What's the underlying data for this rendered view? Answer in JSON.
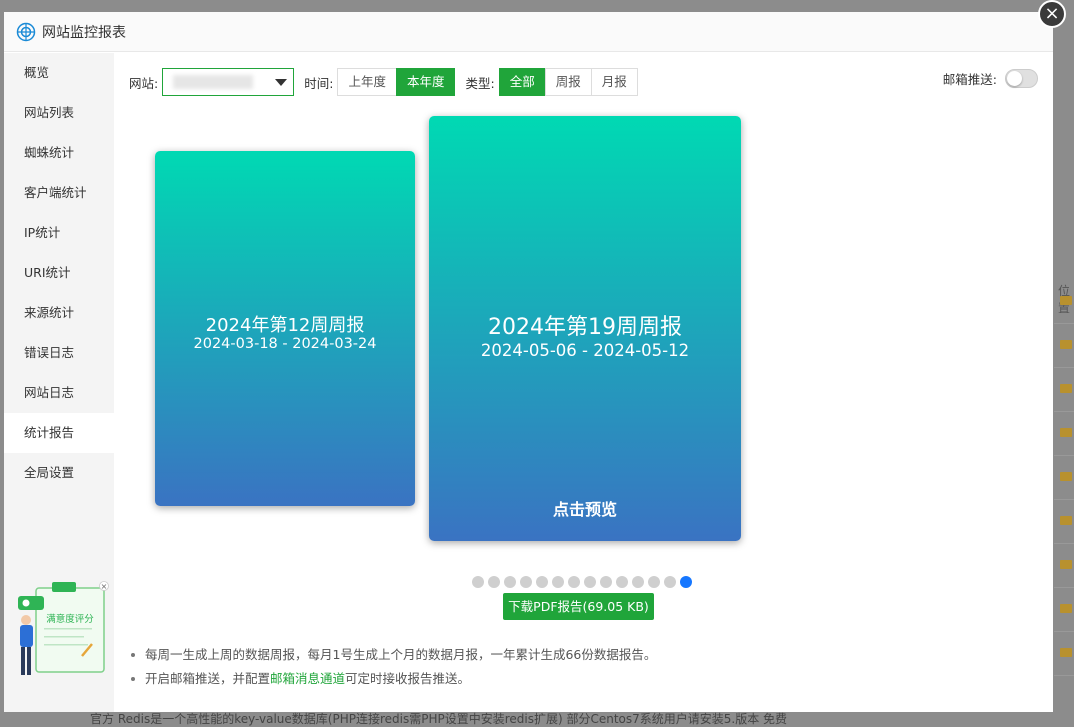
{
  "modal": {
    "title": "网站监控报表",
    "close": "×"
  },
  "sidebar": {
    "items": [
      {
        "label": "概览"
      },
      {
        "label": "网站列表"
      },
      {
        "label": "蜘蛛统计"
      },
      {
        "label": "客户端统计"
      },
      {
        "label": "IP统计"
      },
      {
        "label": "URI统计"
      },
      {
        "label": "来源统计"
      },
      {
        "label": "错误日志"
      },
      {
        "label": "网站日志"
      },
      {
        "label": "统计报告",
        "active": true
      },
      {
        "label": "全局设置"
      }
    ]
  },
  "toolbar": {
    "site_label": "网站:",
    "time_label": "时间:",
    "time_options": [
      "上年度",
      "本年度"
    ],
    "time_selected": "本年度",
    "type_label": "类型:",
    "type_options": [
      "全部",
      "周报",
      "月报"
    ],
    "type_selected": "全部",
    "email_push_label": "邮箱推送:",
    "email_push_on": false
  },
  "reports": {
    "prev": {
      "title": "2024年第12周周报",
      "range": "2024-03-18 - 2024-03-24"
    },
    "current": {
      "title": "2024年第19周周报",
      "range": "2024-05-06 - 2024-05-12",
      "preview": "点击预览"
    }
  },
  "pager": {
    "count": 14,
    "active_index": 13
  },
  "download": {
    "label": "下载PDF报告(69.05 KB)"
  },
  "notes": {
    "line1": "每周一生成上周的数据周报，每月1号生成上个月的数据月报，一年累计生成66份数据报告。",
    "line2_prefix": "开启邮箱推送，并配置",
    "line2_link": "邮箱消息通道",
    "line2_suffix": "可定时接收报告推送。"
  },
  "survey": {
    "label": "满意度评分",
    "close": "×"
  },
  "background": {
    "col_head": "位置",
    "bottom_text": "官方  Redis是一个高性能的key-value数据库(PHP连接redis需PHP设置中安装redis扩展) 部分Centos7系统用户请安装5.版本  免费"
  },
  "colors": {
    "accent": "#20a53a",
    "active_dot": "#1677ff",
    "card_top": "#00d9b3",
    "card_bottom": "#3a73c2"
  }
}
